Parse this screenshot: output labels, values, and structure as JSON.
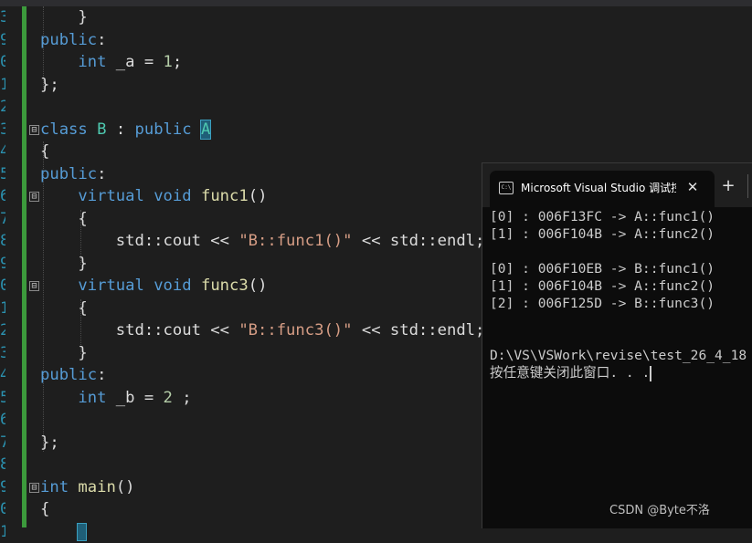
{
  "editor": {
    "line_numbers": [
      "3",
      "9",
      "0",
      "1",
      "2",
      "3",
      "4",
      "5",
      "6",
      "7",
      "8",
      "9",
      "0",
      "1",
      "2",
      "3",
      "4",
      "5",
      "6",
      "7",
      "8",
      "9",
      "0",
      "1"
    ],
    "lines": [
      [
        {
          "t": "    }",
          "c": "pl"
        }
      ],
      [
        {
          "t": "public",
          "c": "kw"
        },
        {
          "t": ":",
          "c": "pl"
        }
      ],
      [
        {
          "t": "    ",
          "c": "pl"
        },
        {
          "t": "int",
          "c": "kw"
        },
        {
          "t": " _a = ",
          "c": "pl"
        },
        {
          "t": "1",
          "c": "num"
        },
        {
          "t": ";",
          "c": "pl"
        }
      ],
      [
        {
          "t": "};",
          "c": "pl"
        }
      ],
      [
        {
          "t": "",
          "c": "pl"
        }
      ],
      [
        {
          "t": "class",
          "c": "kw"
        },
        {
          "t": " ",
          "c": "pl"
        },
        {
          "t": "B",
          "c": "ty"
        },
        {
          "t": " : ",
          "c": "pl"
        },
        {
          "t": "public",
          "c": "kw"
        },
        {
          "t": " ",
          "c": "pl"
        },
        {
          "t": "A",
          "c": "ty hl"
        }
      ],
      [
        {
          "t": "{",
          "c": "pl"
        }
      ],
      [
        {
          "t": "public",
          "c": "kw"
        },
        {
          "t": ":",
          "c": "pl"
        }
      ],
      [
        {
          "t": "    ",
          "c": "pl"
        },
        {
          "t": "virtual",
          "c": "kw"
        },
        {
          "t": " ",
          "c": "pl"
        },
        {
          "t": "void",
          "c": "kw"
        },
        {
          "t": " ",
          "c": "pl"
        },
        {
          "t": "func1",
          "c": "fn"
        },
        {
          "t": "()",
          "c": "pl"
        }
      ],
      [
        {
          "t": "    {",
          "c": "pl"
        }
      ],
      [
        {
          "t": "        std::cout << ",
          "c": "pl"
        },
        {
          "t": "\"B::func1()\"",
          "c": "str"
        },
        {
          "t": " << std::endl;",
          "c": "pl"
        }
      ],
      [
        {
          "t": "    }",
          "c": "pl"
        }
      ],
      [
        {
          "t": "    ",
          "c": "pl"
        },
        {
          "t": "virtual",
          "c": "kw"
        },
        {
          "t": " ",
          "c": "pl"
        },
        {
          "t": "void",
          "c": "kw"
        },
        {
          "t": " ",
          "c": "pl"
        },
        {
          "t": "func3",
          "c": "fn"
        },
        {
          "t": "()",
          "c": "pl"
        }
      ],
      [
        {
          "t": "    {",
          "c": "pl"
        }
      ],
      [
        {
          "t": "        std::cout << ",
          "c": "pl"
        },
        {
          "t": "\"B::func3()\"",
          "c": "str"
        },
        {
          "t": " << std::endl;",
          "c": "pl"
        }
      ],
      [
        {
          "t": "    }",
          "c": "pl"
        }
      ],
      [
        {
          "t": "public",
          "c": "kw"
        },
        {
          "t": ":",
          "c": "pl"
        }
      ],
      [
        {
          "t": "    ",
          "c": "pl"
        },
        {
          "t": "int",
          "c": "kw"
        },
        {
          "t": " _b = ",
          "c": "pl"
        },
        {
          "t": "2",
          "c": "num"
        },
        {
          "t": " ;",
          "c": "pl"
        }
      ],
      [
        {
          "t": "",
          "c": "pl"
        }
      ],
      [
        {
          "t": "};",
          "c": "pl"
        }
      ],
      [
        {
          "t": "",
          "c": "pl"
        }
      ],
      [
        {
          "t": "int",
          "c": "kw"
        },
        {
          "t": " ",
          "c": "pl"
        },
        {
          "t": "main",
          "c": "fn"
        },
        {
          "t": "()",
          "c": "pl"
        }
      ],
      [
        {
          "t": "{",
          "c": "pl"
        }
      ],
      [
        {
          "t": "    ",
          "c": "pl"
        }
      ]
    ],
    "fold_markers": [
      "⊟",
      "⊟",
      "⊟",
      "⊟"
    ]
  },
  "console": {
    "tab_icon": "C:\\",
    "tab_title": "Microsoft Visual Studio 调试控",
    "close_glyph": "✕",
    "new_tab_glyph": "+",
    "lines": [
      "[0] : 006F13FC -> A::func1()",
      "[1] : 006F104B -> A::func2()",
      "",
      "[0] : 006F10EB -> B::func1()",
      "[1] : 006F104B -> A::func2()",
      "[2] : 006F125D -> B::func3()",
      "",
      "",
      "D:\\VS\\VSWork\\revise\\test_26_4_18",
      "按任意键关闭此窗口. . ."
    ]
  },
  "watermark": "CSDN @Byte不洛",
  "colors": {
    "keyword": "#569cd6",
    "type": "#4ec9b0",
    "function": "#dcdcaa",
    "string": "#d69d85",
    "number": "#b5cea8",
    "change_bar": "#3c9a3c"
  }
}
